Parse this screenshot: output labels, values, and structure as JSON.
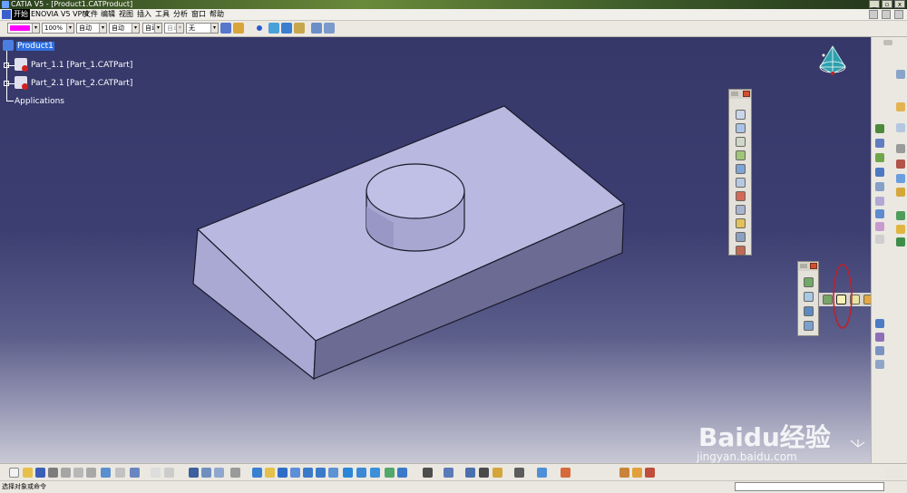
{
  "window": {
    "title": "CATIA V5 - [Product1.CATProduct]"
  },
  "window_controls": {
    "minimize": "_",
    "restore": "▫",
    "close": "x"
  },
  "menu": {
    "items": [
      "开始",
      "ENOVIA V5 VPM",
      "文件",
      "编辑",
      "视图",
      "插入",
      "工具",
      "分析",
      "窗口",
      "帮助"
    ]
  },
  "toolbar": {
    "color_value": "#ff00ff",
    "opacity_value": "100%",
    "linetype_value": "自动",
    "thickness_value": "自动",
    "point_value": "自动",
    "layer_value": "自动",
    "layer_name": "无"
  },
  "tree": {
    "root": "Product1",
    "children": [
      "Part_1.1 [Part_1.CATPart]",
      "Part_2.1 [Part_2.CATPart]"
    ],
    "applications": "Applications"
  },
  "statusbar": {
    "message": "选择对象或命令"
  },
  "watermark": {
    "logo": "Baidu经验",
    "url": "jingyan.baidu.com"
  },
  "colors": {
    "selection": "#2f6fe0",
    "model_top": "#b9b8e0",
    "model_front": "#aaa9d4",
    "highlight_ellipse": "#c0202a"
  },
  "icons": [
    "catia-logo-icon",
    "compass-icon",
    "product-icon",
    "part-icon",
    "annotation-marker-icon"
  ]
}
